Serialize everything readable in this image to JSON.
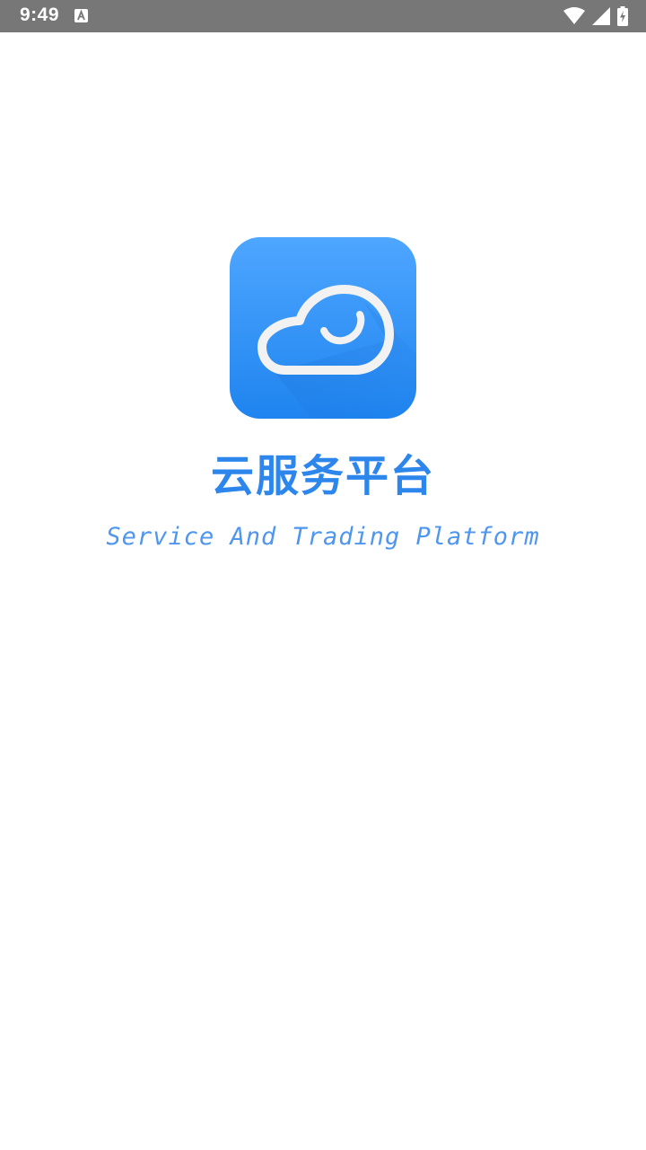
{
  "status_bar": {
    "time": "9:49",
    "notification_icon": "text-a-icon",
    "icons": [
      "wifi-icon",
      "cellular-signal-icon",
      "battery-charging-icon"
    ]
  },
  "splash": {
    "logo_icon": "cloud-smile-icon",
    "title": "云服务平台",
    "subtitle": "Service And Trading Platform"
  },
  "colors": {
    "status_bar_bg": "#777777",
    "logo_gradient_top": "#4ea6ff",
    "logo_gradient_bottom": "#1f84ef",
    "title": "#2c86ec",
    "subtitle": "#4f96ee"
  }
}
